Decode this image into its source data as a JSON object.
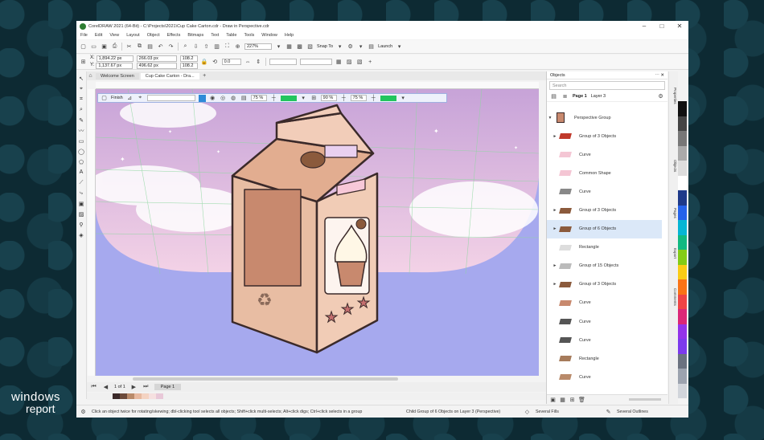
{
  "window": {
    "title": "CorelDRAW 2021 (64-Bit) - C:\\Projects\\2021\\Cup Cake Carton.cdr - Draw in Perspective.cdr"
  },
  "menu": [
    "File",
    "Edit",
    "View",
    "Layout",
    "Object",
    "Effects",
    "Bitmaps",
    "Text",
    "Table",
    "Tools",
    "Window",
    "Help"
  ],
  "toolbar": {
    "zoom": "227%",
    "snap_to": "Snap To",
    "launch": "Launch"
  },
  "propbar": {
    "x": "1,894.22 px",
    "y": "1,137.67 px",
    "w": "266.03 px",
    "h": "496.62 px",
    "sx": "108.2",
    "sy": "108.2",
    "rotation": "0.0"
  },
  "doc_tabs": [
    "Welcome Screen",
    "Cup Cake Carton - Dra..."
  ],
  "persp_toolbar": {
    "finish": "Finish",
    "opacity1": "75 %",
    "opacity2": "90 %",
    "opacity3": "75 %",
    "accent": "#22c55e"
  },
  "page_bar": {
    "pager": "1 of 1",
    "page_tab": "Page 1"
  },
  "palette_colors": [
    "#3b2a2a",
    "#6b4a3a",
    "#b98a6a",
    "#e7b9a0",
    "#f4d3c2",
    "#f6e0e0",
    "#e8c8d8"
  ],
  "status": {
    "hint": "Click an object twice for rotating/skewing; dbl-clicking tool selects all objects; Shift+click multi-selects; Alt+click digs; Ctrl+click selects in a group",
    "selection": "Child Group of 6 Objects on Layer 3  (Perspective)",
    "fill": "Several Fills",
    "outline": "Several Outlines"
  },
  "objects_panel": {
    "title": "Objects",
    "search_placeholder": "Search",
    "page": "Page 1",
    "layer": "Layer 3",
    "group": "Perspective Group",
    "items": [
      {
        "label": "Group of 3 Objects",
        "arrow": "►",
        "selected": false
      },
      {
        "label": "Curve",
        "arrow": "",
        "selected": false
      },
      {
        "label": "Common Shape",
        "arrow": "",
        "selected": false
      },
      {
        "label": "Curve",
        "arrow": "",
        "selected": false
      },
      {
        "label": "Group of 3 Objects",
        "arrow": "►",
        "selected": false
      },
      {
        "label": "Group of 6 Objects",
        "arrow": "►",
        "selected": true
      },
      {
        "label": "Rectangle",
        "arrow": "",
        "selected": false
      },
      {
        "label": "Group of 15 Objects",
        "arrow": "►",
        "selected": false
      },
      {
        "label": "Group of 3 Objects",
        "arrow": "►",
        "selected": false
      },
      {
        "label": "Curve",
        "arrow": "",
        "selected": false
      },
      {
        "label": "Curve",
        "arrow": "",
        "selected": false
      },
      {
        "label": "Curve",
        "arrow": "",
        "selected": false
      },
      {
        "label": "Rectangle",
        "arrow": "",
        "selected": false
      },
      {
        "label": "Curve",
        "arrow": "",
        "selected": false
      }
    ]
  },
  "right_tabs": [
    "Properties",
    "Objects",
    "Pages",
    "Export",
    "Comments"
  ],
  "color_strip": [
    "#111111",
    "#444444",
    "#777777",
    "#aaaaaa",
    "#dddddd",
    "#ffffff",
    "#1e3a8a",
    "#2563eb",
    "#06b6d4",
    "#10b981",
    "#84cc16",
    "#facc15",
    "#f97316",
    "#ef4444",
    "#db2777",
    "#9333ea",
    "#7c3aed",
    "#6b7280",
    "#9ca3af",
    "#d1d5db"
  ],
  "watermark": {
    "line1": "windows",
    "line2": "report"
  }
}
